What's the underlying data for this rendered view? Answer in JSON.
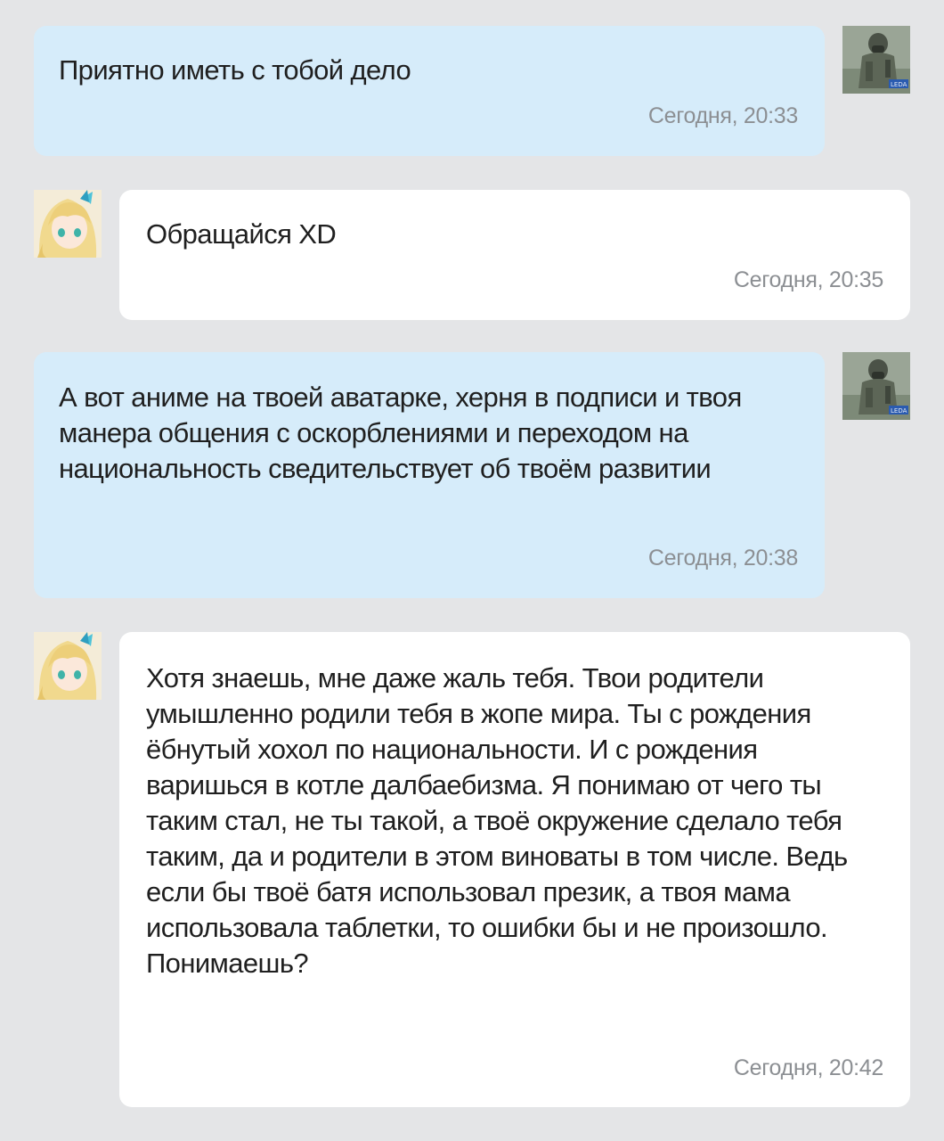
{
  "messages": [
    {
      "side": "outgoing",
      "avatar": "stalker-avatar",
      "text": "Приятно иметь с тобой дело",
      "time": "Сегодня, 20:33"
    },
    {
      "side": "incoming",
      "avatar": "anime-avatar",
      "text": "Обращайся XD",
      "time": "Сегодня, 20:35"
    },
    {
      "side": "outgoing",
      "avatar": "stalker-avatar",
      "text": "А вот аниме на твоей аватарке, херня в подписи и твоя манера общения с оскорблениями и переходом на национальность сведительствует об твоём развитии",
      "time": "Сегодня, 20:38"
    },
    {
      "side": "incoming",
      "avatar": "anime-avatar",
      "text": "Хотя знаешь, мне даже жаль тебя. Твои родители умышленно родили тебя в жопе мира. Ты с рождения ёбнутый хохол по национальности. И с рождения варишься в котле далбаебизма. Я понимаю от чего ты таким стал, не ты такой, а твоё окружение сделало тебя таким, да и родители в этом виноваты в том числе. Ведь если бы твоё батя использовал презик, а твоя мама использовала таблетки, то ошибки бы и не произошло. Понимаешь?",
      "time": "Сегодня, 20:42"
    }
  ],
  "colors": {
    "background": "#e4e5e7",
    "outgoing_bubble": "#d6ecfa",
    "incoming_bubble": "#ffffff",
    "timestamp": "#8c8f93"
  }
}
